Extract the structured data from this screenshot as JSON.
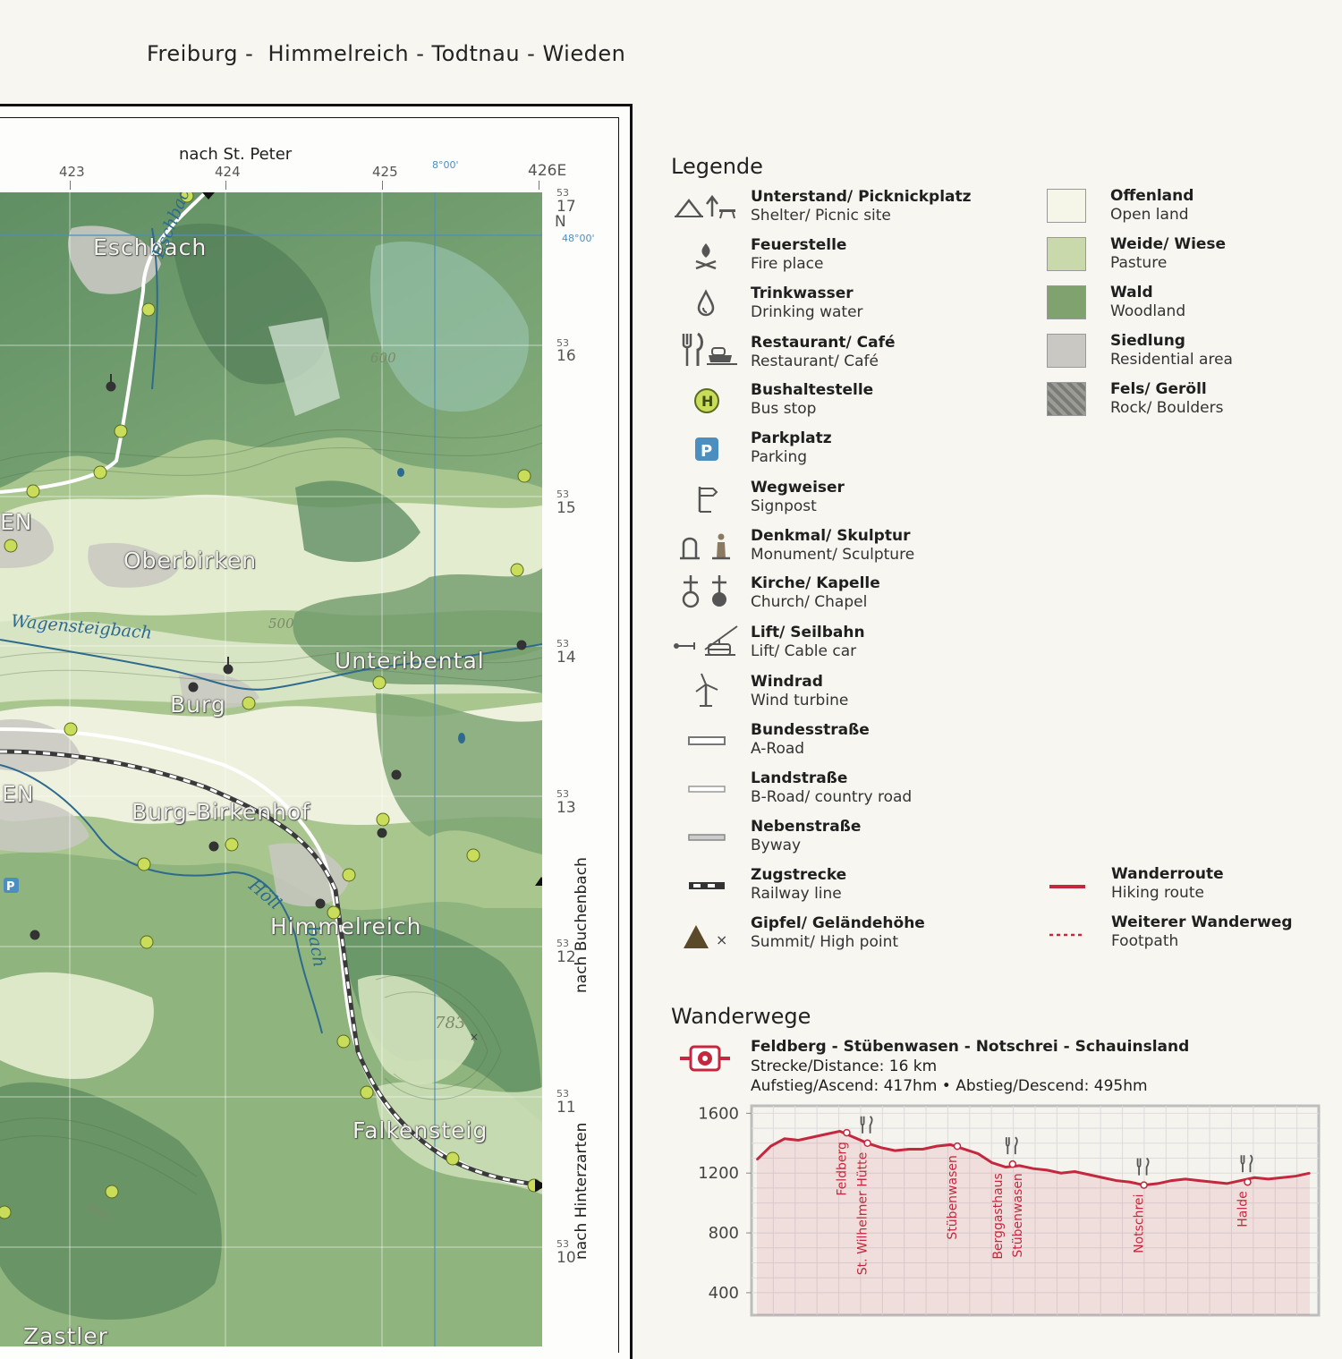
{
  "header": {
    "title": "Freiburg -  Himmelreich - Todtnau - Wieden"
  },
  "map": {
    "top_direction": "nach St. Peter",
    "right_direction_1": "nach Buchenbach",
    "right_direction_2": "nach Hinterzarten",
    "easting_labels": [
      "423",
      "424",
      "425",
      "426E"
    ],
    "meridian_label": "8°00'",
    "parallel_label": "48°00'",
    "northing_prefix": "53",
    "northing_labels": [
      "17",
      "16",
      "15",
      "14",
      "13",
      "12",
      "11",
      "10"
    ],
    "north_letter": "N",
    "places": {
      "eschbach": "Eschbach",
      "oberbirken": "Oberbirken",
      "unteribental": "Unteribental",
      "burg": "Burg",
      "burg_birkenhof": "Burg-Birkenhof",
      "himmelreich": "Himmelreich",
      "falkensteig": "Falkensteig",
      "zastler": "Zastler",
      "edge_en_1": "EN",
      "edge_en_2": "EN"
    },
    "streams": {
      "eschbach_stream": "Eschbach",
      "wagensteigbach": "Wagensteigbach",
      "hoellbach_1": "Höll",
      "hoellbach_2": "bach"
    },
    "contours": {
      "c600a": "600",
      "c500": "500",
      "c600b": "600",
      "summit": "783"
    },
    "colors": {
      "forest": "#6f9a6a",
      "pasture": "#cddcb0",
      "open": "#f1f3e2",
      "water": "#2d6a8e",
      "route": "#c4283e",
      "bus_stop": "#c9dd5a"
    }
  },
  "legend": {
    "title": "Legende",
    "items": [
      {
        "de": "Unterstand/ Picknickplatz",
        "en": "Shelter/ Picnic site",
        "icon": "shelter-picnic-icon"
      },
      {
        "de": "Feuerstelle",
        "en": "Fire place",
        "icon": "fire-icon"
      },
      {
        "de": "Trinkwasser",
        "en": "Drinking water",
        "icon": "water-drop-icon"
      },
      {
        "de": "Restaurant/ Café",
        "en": "Restaurant/ Café",
        "icon": "restaurant-icon"
      },
      {
        "de": "Bushaltestelle",
        "en": "Bus stop",
        "icon": "bus-stop-icon"
      },
      {
        "de": "Parkplatz",
        "en": "Parking",
        "icon": "parking-icon"
      },
      {
        "de": "Wegweiser",
        "en": "Signpost",
        "icon": "signpost-icon"
      },
      {
        "de": "Denkmal/ Skulptur",
        "en": "Monument/ Sculpture",
        "icon": "monument-icon"
      },
      {
        "de": "Kirche/ Kapelle",
        "en": "Church/ Chapel",
        "icon": "church-icon"
      },
      {
        "de": "Lift/ Seilbahn",
        "en": "Lift/ Cable car",
        "icon": "lift-icon"
      },
      {
        "de": "Windrad",
        "en": "Wind turbine",
        "icon": "wind-turbine-icon"
      },
      {
        "de": "Bundesstraße",
        "en": "A-Road",
        "icon": "a-road-icon"
      },
      {
        "de": "Landstraße",
        "en": "B-Road/ country road",
        "icon": "b-road-icon"
      },
      {
        "de": "Nebenstraße",
        "en": "Byway",
        "icon": "byway-icon"
      },
      {
        "de": "Zugstrecke",
        "en": "Railway line",
        "icon": "railway-icon"
      },
      {
        "de": "Gipfel/ Geländehöhe",
        "en": "Summit/ High point",
        "icon": "summit-icon"
      }
    ],
    "areas": [
      {
        "de": "Offenland",
        "en": "Open land",
        "color": "#f6f6e8"
      },
      {
        "de": "Weide/ Wiese",
        "en": "Pasture",
        "color": "#cad9ac"
      },
      {
        "de": "Wald",
        "en": "Woodland",
        "color": "#7fa26e"
      },
      {
        "de": "Siedlung",
        "en": "Residential area",
        "color": "#c9c8c2"
      },
      {
        "de": "Fels/ Geröll",
        "en": "Rock/ Boulders",
        "color": "#8a8a86"
      }
    ],
    "routes": [
      {
        "de": "Wanderroute",
        "en": "Hiking route"
      },
      {
        "de": "Weiterer Wanderweg",
        "en": "Footpath"
      }
    ]
  },
  "route_section": {
    "title": "Wanderwege",
    "name": "Feldberg - Stübenwasen - Notschrei - Schauinsland",
    "distance": "Strecke/Distance: 16 km",
    "ascent": "Aufstieg/Ascend: 417hm • Abstieg/Descend: 495hm"
  },
  "chart_data": {
    "type": "area",
    "title": "",
    "xlabel": "",
    "ylabel": "",
    "yticks": [
      1600,
      1200,
      800,
      400
    ],
    "ylim": [
      250,
      1650
    ],
    "xlim": [
      0,
      16
    ],
    "x": [
      0,
      0.4,
      0.8,
      1.2,
      1.6,
      2.0,
      2.4,
      2.8,
      3.2,
      3.6,
      4.0,
      4.4,
      4.8,
      5.2,
      5.6,
      6.0,
      6.4,
      6.8,
      7.2,
      7.6,
      8.0,
      8.4,
      8.8,
      9.2,
      9.6,
      10.0,
      10.4,
      10.8,
      11.2,
      11.6,
      12.0,
      12.4,
      12.8,
      13.2,
      13.6,
      14.0,
      14.4,
      14.8,
      15.2,
      15.6,
      16.0
    ],
    "y": [
      1290,
      1380,
      1430,
      1420,
      1440,
      1460,
      1480,
      1440,
      1400,
      1370,
      1350,
      1360,
      1360,
      1380,
      1390,
      1360,
      1330,
      1270,
      1240,
      1250,
      1230,
      1220,
      1200,
      1210,
      1190,
      1170,
      1150,
      1140,
      1120,
      1130,
      1150,
      1160,
      1150,
      1140,
      1130,
      1150,
      1170,
      1160,
      1170,
      1180,
      1200
    ],
    "waypoints": [
      {
        "label": "Feldberg",
        "x": 2.6,
        "y": 1470,
        "restaurant": false
      },
      {
        "label": "St. Wilhelmer Hütte",
        "x": 3.2,
        "y": 1400,
        "restaurant": true
      },
      {
        "label": "Stübenwasen",
        "x": 5.8,
        "y": 1380,
        "restaurant": false
      },
      {
        "label": "Berggasthaus Stübenwasen",
        "x": 7.4,
        "y": 1260,
        "restaurant": true
      },
      {
        "label": "Notschrei",
        "x": 11.2,
        "y": 1120,
        "restaurant": true
      },
      {
        "label": "Halde",
        "x": 14.2,
        "y": 1140,
        "restaurant": true
      }
    ]
  }
}
